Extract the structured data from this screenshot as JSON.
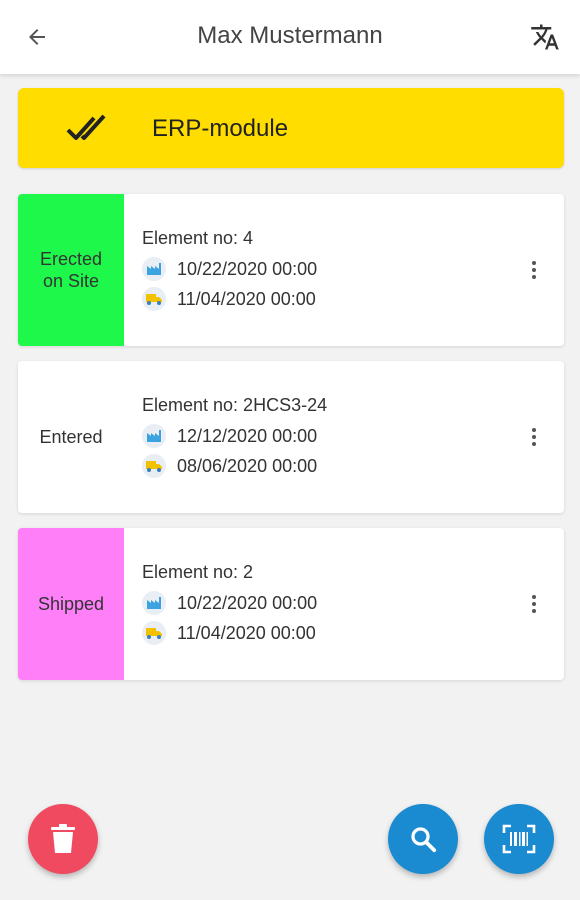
{
  "header": {
    "title": "Max Mustermann",
    "back_icon": "arrow-left-icon",
    "translate_icon": "translate-icon"
  },
  "banner": {
    "label": "ERP-module",
    "icon": "double-check-icon",
    "color": "#ffdd00"
  },
  "cards": [
    {
      "status": "Erected\non Site",
      "status_color": "#1ef84b",
      "element": "Element no: 4",
      "production_date": "10/22/2020 00:00",
      "delivery_date": "11/04/2020 00:00"
    },
    {
      "status": "Entered",
      "status_color": "#ffffff",
      "element": "Element no: 2HCS3-24",
      "production_date": "12/12/2020 00:00",
      "delivery_date": "08/06/2020 00:00"
    },
    {
      "status": "Shipped",
      "status_color": "#ff7ff9",
      "element": "Element no: 2",
      "production_date": "10/22/2020 00:00",
      "delivery_date": "11/04/2020 00:00"
    }
  ],
  "actions": {
    "delete_icon": "trash-icon",
    "search_icon": "search-icon",
    "scan_icon": "barcode-scan-icon",
    "delete_color": "#ef4a5f",
    "primary_color": "#1a8bd1"
  }
}
